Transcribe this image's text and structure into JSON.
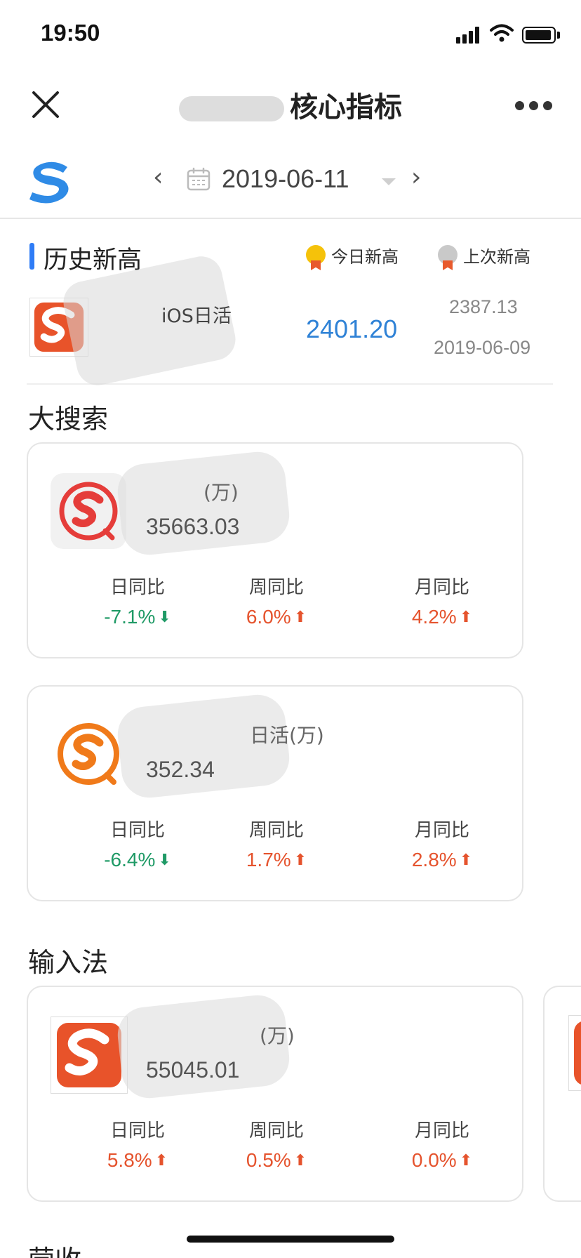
{
  "status_bar": {
    "time": "19:50"
  },
  "nav": {
    "title": "核心指标"
  },
  "date_bar": {
    "date": "2019-06-11",
    "prev": "‹",
    "next": "›"
  },
  "history": {
    "title": "历史新高",
    "legend_today": "今日新高",
    "legend_last": "上次新高",
    "metric": "iOS日活",
    "value": "2401.20",
    "prev_value": "2387.13",
    "prev_date": "2019-06-09"
  },
  "sections": {
    "search": {
      "title": "大搜索",
      "cards": [
        {
          "label": "(万)",
          "value": "35663.03",
          "stats": [
            {
              "label": "日同比",
              "value": "-7.1%",
              "dir": "down"
            },
            {
              "label": "周同比",
              "value": "6.0%",
              "dir": "up"
            },
            {
              "label": "月同比",
              "value": "4.2%",
              "dir": "up"
            }
          ]
        },
        {
          "label": "日活(万)",
          "value": "352.34",
          "stats": [
            {
              "label": "日同比",
              "value": "-6.4%",
              "dir": "down"
            },
            {
              "label": "周同比",
              "value": "1.7%",
              "dir": "up"
            },
            {
              "label": "月同比",
              "value": "2.8%",
              "dir": "up"
            }
          ]
        }
      ]
    },
    "input": {
      "title": "输入法",
      "cards": [
        {
          "label": "(万)",
          "value": "55045.01",
          "stats": [
            {
              "label": "日同比",
              "value": "5.8%",
              "dir": "up"
            },
            {
              "label": "周同比",
              "value": "0.5%",
              "dir": "up"
            },
            {
              "label": "月同比",
              "value": "0.0%",
              "dir": "up"
            }
          ]
        }
      ]
    },
    "revenue": {
      "title": "营收"
    }
  },
  "icons": {
    "close": "close-icon",
    "more": "more-icon",
    "calendar": "calendar-icon",
    "medal_gold": "gold-medal-icon",
    "medal_silver": "silver-medal-icon"
  },
  "colors": {
    "accent_blue": "#2f7cf6",
    "value_blue": "#2f82d6",
    "up_red": "#e5532d",
    "down_green": "#1f9a66"
  }
}
